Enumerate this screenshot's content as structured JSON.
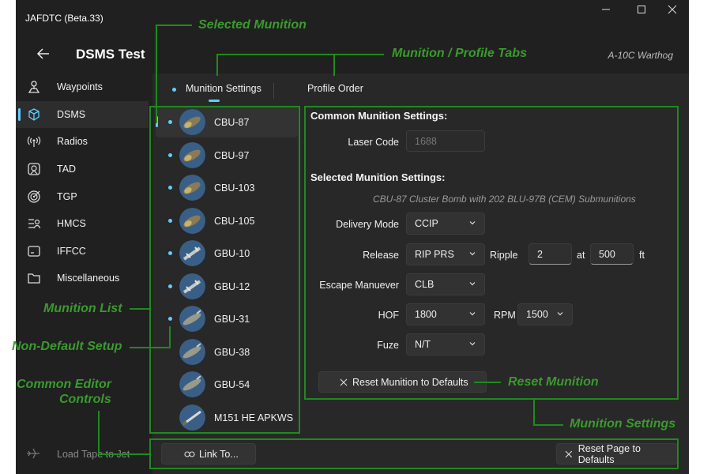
{
  "window": {
    "title": "JAFDTC (Beta.33)",
    "minimize": "—",
    "maximize": "☐",
    "close": "✕"
  },
  "header": {
    "page_title": "DSMS Test",
    "airframe": "A-10C Warthog"
  },
  "nav": {
    "items": [
      {
        "label": "Waypoints",
        "icon": "waypoint-icon"
      },
      {
        "label": "DSMS",
        "icon": "dsms-icon"
      },
      {
        "label": "Radios",
        "icon": "radio-icon"
      },
      {
        "label": "TAD",
        "icon": "tad-icon"
      },
      {
        "label": "TGP",
        "icon": "tgp-icon"
      },
      {
        "label": "HMCS",
        "icon": "hmcs-icon"
      },
      {
        "label": "IFFCC",
        "icon": "iffcc-icon"
      },
      {
        "label": "Miscellaneous",
        "icon": "folder-icon"
      }
    ],
    "selected": "DSMS",
    "load_tape": "Load Tape to Jet"
  },
  "tabs": [
    {
      "label": "Munition Settings"
    },
    {
      "label": "Profile Order"
    }
  ],
  "munitions": [
    {
      "name": "CBU-87",
      "modified": true,
      "kind": "bomb"
    },
    {
      "name": "CBU-97",
      "modified": true,
      "kind": "bomb"
    },
    {
      "name": "CBU-103",
      "modified": true,
      "kind": "bomb"
    },
    {
      "name": "CBU-105",
      "modified": true,
      "kind": "bomb"
    },
    {
      "name": "GBU-10",
      "modified": true,
      "kind": "guided"
    },
    {
      "name": "GBU-12",
      "modified": true,
      "kind": "guided"
    },
    {
      "name": "GBU-31",
      "modified": true,
      "kind": "jdam"
    },
    {
      "name": "GBU-38",
      "modified": false,
      "kind": "jdam"
    },
    {
      "name": "GBU-54",
      "modified": false,
      "kind": "jdam"
    },
    {
      "name": "M151 HE APKWS",
      "modified": false,
      "kind": "rocket"
    }
  ],
  "settings": {
    "common_header": "Common Munition Settings:",
    "laser_code_label": "Laser Code",
    "laser_code_placeholder": "1688",
    "selected_header": "Selected Munition Settings:",
    "description": "CBU-87 Cluster Bomb with 202 BLU-97B (CEM) Submunitions",
    "delivery_mode_label": "Delivery Mode",
    "delivery_mode": "CCIP",
    "release_label": "Release",
    "release": "RIP PRS",
    "ripple_label": "Ripple",
    "ripple_qty": "2",
    "at_label": "at",
    "ripple_ft": "500",
    "ft_label": "ft",
    "escape_label": "Escape Manuever",
    "escape": "CLB",
    "hof_label": "HOF",
    "hof": "1800",
    "rpm_label": "RPM",
    "rpm": "1500",
    "fuze_label": "Fuze",
    "fuze": "N/T",
    "reset_munition": "Reset Munition to Defaults"
  },
  "footer": {
    "link_to": "Link To...",
    "reset_page": "Reset Page to Defaults"
  },
  "annotations": {
    "selected_munition": "Selected Munition",
    "tabs": "Munition / Profile Tabs",
    "munition_list": "Munition List",
    "non_default": "Non-Default Setup",
    "common_controls_1": "Common Editor",
    "common_controls_2": "Controls",
    "reset_munition": "Reset Munition",
    "munition_settings": "Munition Settings"
  },
  "colors": {
    "accent": "#60cdff",
    "annotation": "#3a9a2e",
    "annotation_box": "#1f8a1f",
    "background": "#202020"
  }
}
